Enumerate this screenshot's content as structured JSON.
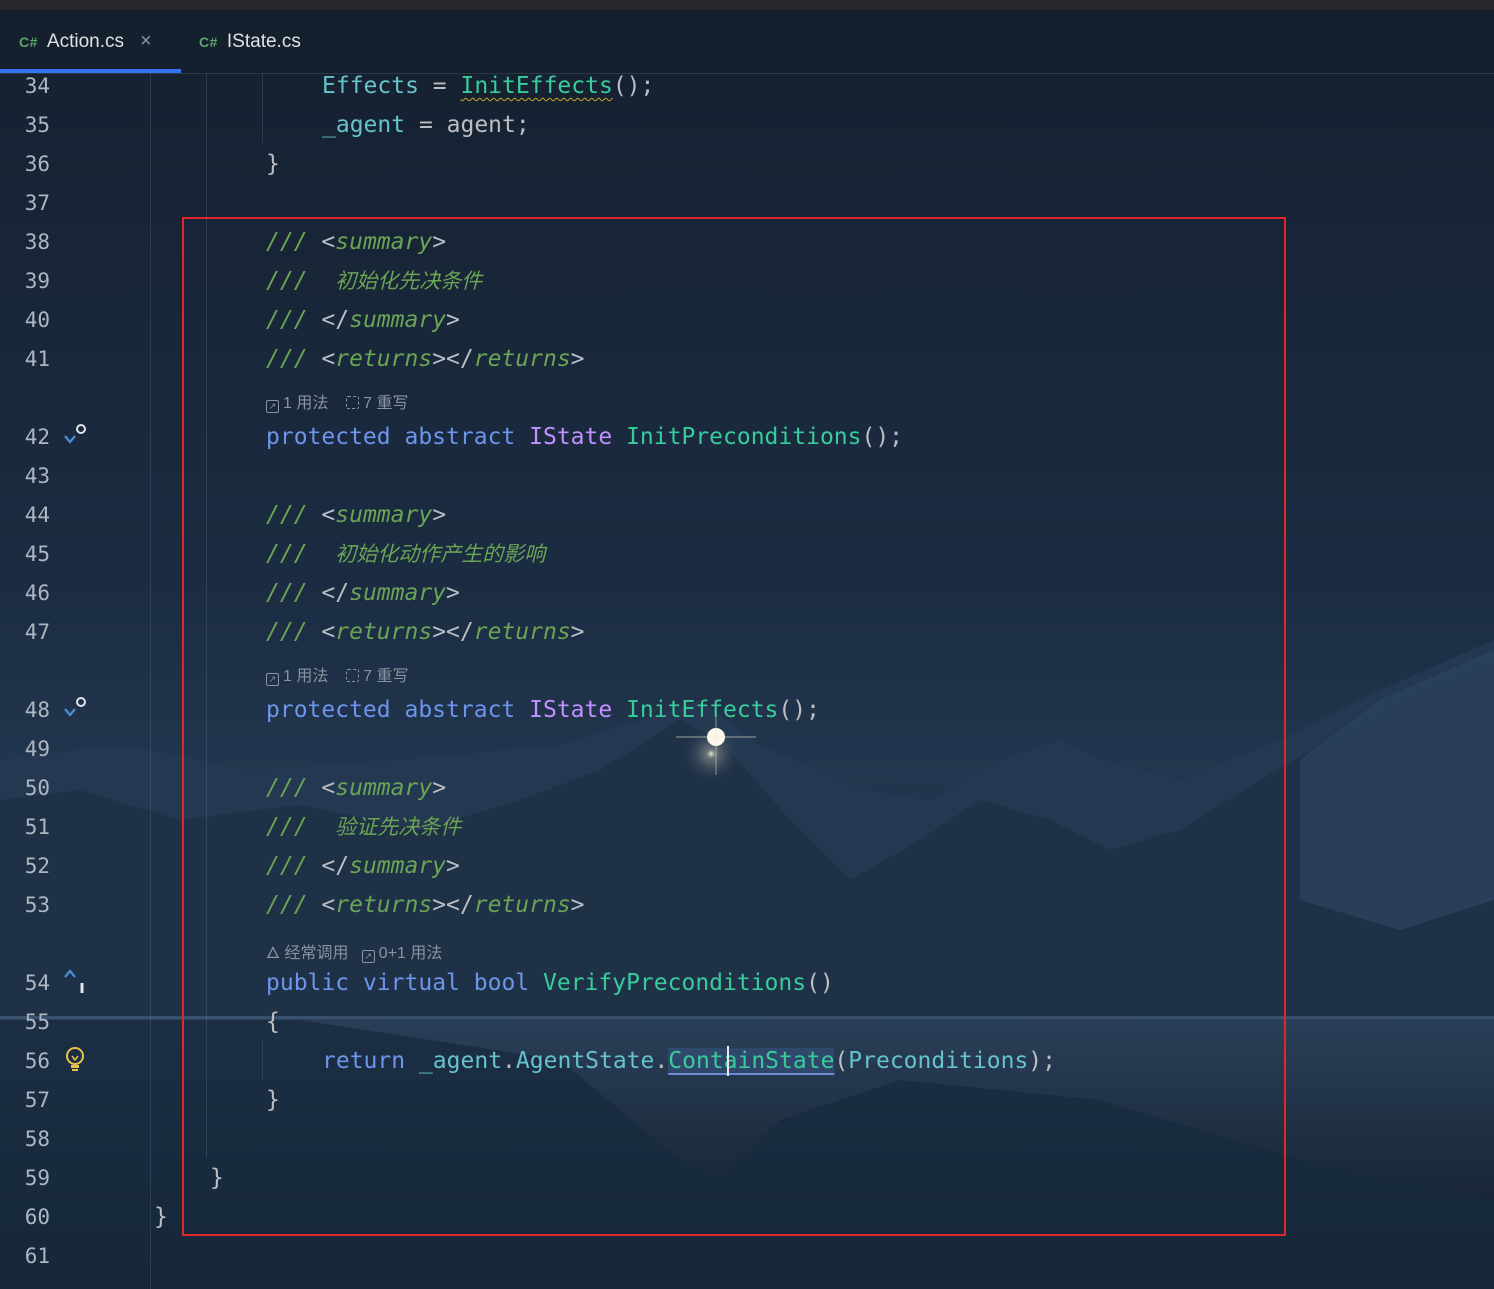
{
  "tabs": [
    {
      "lang_badge": "C#",
      "label": "Action.cs",
      "close": "×",
      "active": true
    },
    {
      "lang_badge": "C#",
      "label": "IState.cs",
      "active": false
    }
  ],
  "line_numbers": [
    "34",
    "35",
    "36",
    "37",
    "38",
    "39",
    "40",
    "41",
    "42",
    "43",
    "44",
    "45",
    "46",
    "47",
    "48",
    "49",
    "50",
    "51",
    "52",
    "53",
    "54",
    "55",
    "56",
    "57",
    "58",
    "59",
    "60",
    "61"
  ],
  "code": {
    "l34": {
      "a": "Effects",
      "b": " = ",
      "c": "InitEffects",
      "d": "();"
    },
    "l35": {
      "a": "_agent",
      "b": " = agent;"
    },
    "l36": "}",
    "l38": {
      "slashes": "/// ",
      "open": "<",
      "tag": "summary",
      "close": ">"
    },
    "l39": {
      "slashes": "///  ",
      "text": "初始化先决条件"
    },
    "l40": {
      "slashes": "/// ",
      "open": "</",
      "tag": "summary",
      "close": ">"
    },
    "l41": {
      "slashes": "/// ",
      "o1": "<",
      "t1": "returns",
      "c1": "></",
      "t2": "returns",
      "c2": ">"
    },
    "hint42": {
      "usages": "1 用法",
      "overrides": "7 重写"
    },
    "l42": {
      "kw1": "protected",
      "kw2": "abstract",
      "type": "IState",
      "fn": "InitPreconditions",
      "tail": "();"
    },
    "l44": {
      "slashes": "/// ",
      "open": "<",
      "tag": "summary",
      "close": ">"
    },
    "l45": {
      "slashes": "///  ",
      "text": "初始化动作产生的影响"
    },
    "l46": {
      "slashes": "/// ",
      "open": "</",
      "tag": "summary",
      "close": ">"
    },
    "l47": {
      "slashes": "/// ",
      "o1": "<",
      "t1": "returns",
      "c1": "></",
      "t2": "returns",
      "c2": ">"
    },
    "hint48": {
      "usages": "1 用法",
      "overrides": "7 重写"
    },
    "l48": {
      "kw1": "protected",
      "kw2": "abstract",
      "type": "IState",
      "fn": "InitEffects",
      "tail": "();"
    },
    "l50": {
      "slashes": "/// ",
      "open": "<",
      "tag": "summary",
      "close": ">"
    },
    "l51": {
      "slashes": "///  ",
      "text": "验证先决条件"
    },
    "l52": {
      "slashes": "/// ",
      "open": "</",
      "tag": "summary",
      "close": ">"
    },
    "l53": {
      "slashes": "/// ",
      "o1": "<",
      "t1": "returns",
      "c1": "></",
      "t2": "returns",
      "c2": ">"
    },
    "hint54": {
      "frequent": "经常调用",
      "usages": "0+1 用法"
    },
    "l54": {
      "kw1": "public",
      "kw2": "virtual",
      "kw3": "bool",
      "fn": "VerifyPreconditions",
      "tail": "()"
    },
    "l55": "{",
    "l56": {
      "kw": "return",
      "field": "_agent",
      "dot1": ".",
      "prop": "AgentState",
      "dot2": ".",
      "fn": "ContainState",
      "p1": "(",
      "arg": "Preconditions",
      "p2": ");"
    },
    "l57": "}",
    "l59": "}",
    "l60": "}"
  },
  "gutter_icons": {
    "l42": "implemented-down-icon",
    "l48": "implemented-down-icon",
    "l54": "overrides-up-icon",
    "l56": "lightbulb-icon"
  },
  "colors": {
    "keyword": "#6c95eb",
    "type": "#c191ff",
    "method": "#39cc9b",
    "field": "#66c3cc",
    "comment": "#6aa455",
    "selection_box": "#e0262c",
    "active_tab_underline": "#3574f0"
  }
}
